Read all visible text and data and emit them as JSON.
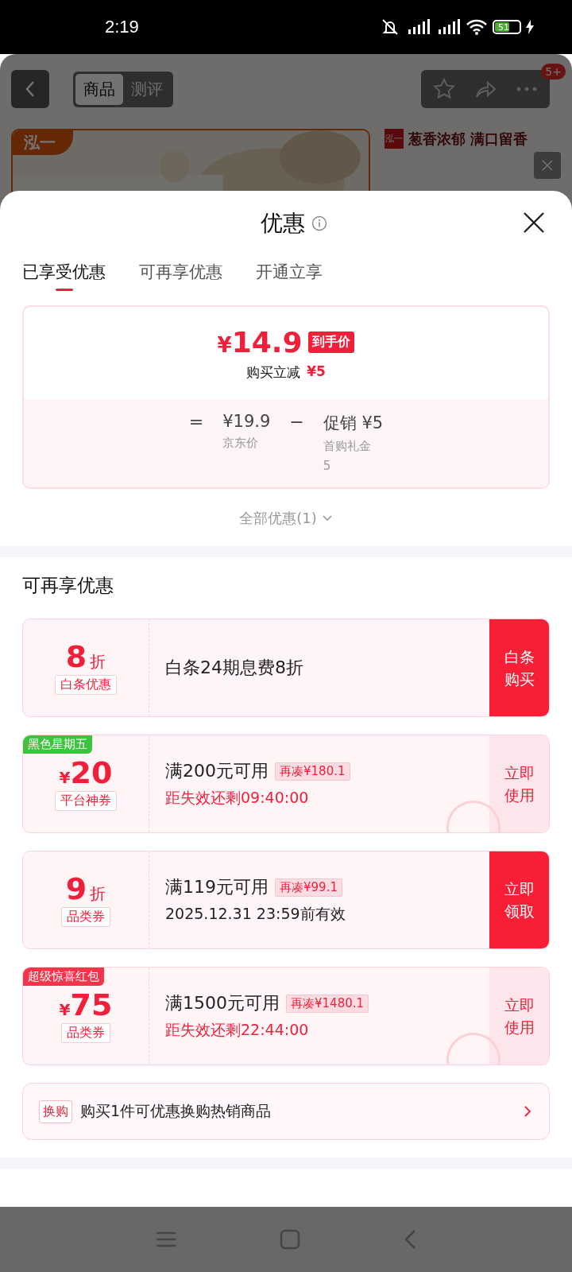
{
  "status_bar": {
    "time": "2:19",
    "battery": "51"
  },
  "background_page": {
    "tabs": [
      {
        "label": "商品",
        "selected": true
      },
      {
        "label": "测评",
        "selected": false
      }
    ],
    "badge": "5+",
    "brand_tag": "泓一",
    "brand_logo": "泓一",
    "slogan": "葱香浓郁 满口留香"
  },
  "sheet": {
    "title": "优惠",
    "tabs": [
      {
        "label": "已享受优惠",
        "selected": true
      },
      {
        "label": "可再享优惠",
        "selected": false
      },
      {
        "label": "开通立享",
        "selected": false
      }
    ],
    "summary": {
      "currency": "¥",
      "price": "14.9",
      "price_tag": "到手价",
      "saving_label": "购买立减",
      "saving": "¥5",
      "breakdown": [
        {
          "kind": "sign",
          "text": "="
        },
        {
          "kind": "term",
          "value": "¥19.9",
          "captions": [
            "京东价"
          ]
        },
        {
          "kind": "sign",
          "text": "−"
        },
        {
          "kind": "term",
          "value": "促销 ¥5",
          "captions": [
            "首购礼金",
            "5"
          ]
        }
      ]
    },
    "all_offers": "全部优惠(1)",
    "section_title": "可再享优惠",
    "coupons": [
      {
        "kind": "discount",
        "amount": "8",
        "unit": "折",
        "type": "白条优惠",
        "title": "白条24期息费8折",
        "action": [
          "白条",
          "购买"
        ],
        "highlighted": true,
        "claimed": false
      },
      {
        "kind": "cash",
        "ribbon": "黑色星期五",
        "color": "#3cc43f",
        "amount": "20",
        "unit": "¥",
        "type": "平台神券",
        "title": "满200元可用",
        "gap": "再凑¥180.1",
        "note": "距失效还剩09:40:00",
        "note_red": true,
        "action": [
          "立即",
          "使用"
        ],
        "highlighted": false,
        "claimed": true
      },
      {
        "kind": "discount",
        "amount": "9",
        "unit": "折",
        "type": "品类券",
        "title": "满119元可用",
        "gap": "再凑¥99.1",
        "note": "2025.12.31 23:59前有效",
        "note_red": false,
        "action": [
          "立即",
          "领取"
        ],
        "highlighted": true,
        "claimed": false
      },
      {
        "kind": "cash",
        "ribbon": "超级惊喜红包",
        "color": "#f5334a",
        "amount": "75",
        "unit": "¥",
        "type": "品类券",
        "title": "满1500元可用",
        "gap": "再凑¥1480.1",
        "note": "距失效还剩22:44:00",
        "note_red": true,
        "action": [
          "立即",
          "使用"
        ],
        "highlighted": false,
        "claimed": true
      }
    ],
    "exchange": {
      "tag": "换购",
      "text": "购买1件可优惠换购热销商品"
    }
  }
}
